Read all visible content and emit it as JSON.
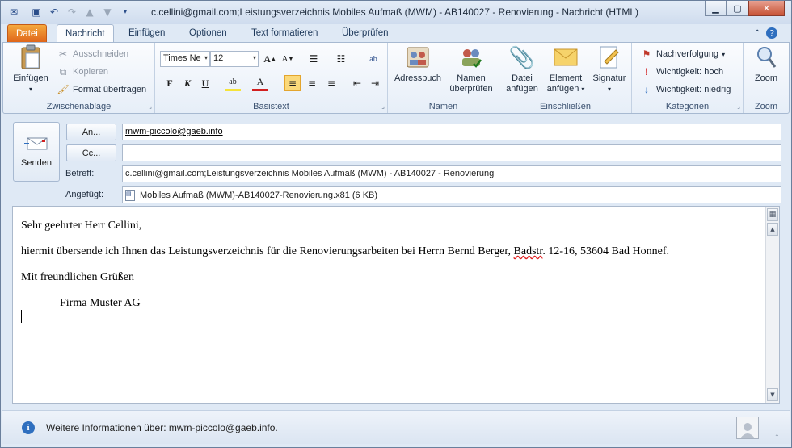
{
  "window": {
    "title": "c.cellini@gmail.com;Leistungsverzeichnis Mobiles Aufmaß (MWM) - AB140027 - Renovierung  -  Nachricht (HTML)"
  },
  "quick_access": [
    "outlook-icon",
    "save-icon",
    "undo-icon",
    "redo-icon",
    "up-icon",
    "down-icon",
    "customize-icon"
  ],
  "window_controls": {
    "minimize": "▁",
    "maximize": "▢",
    "close": "✕"
  },
  "tabs": [
    {
      "label": "Datei"
    },
    {
      "label": "Nachricht"
    },
    {
      "label": "Einfügen"
    },
    {
      "label": "Optionen"
    },
    {
      "label": "Text formatieren"
    },
    {
      "label": "Überprüfen"
    }
  ],
  "ribbon": {
    "zwischenablage": {
      "label": "Zwischenablage",
      "einfuegen": "Einfügen",
      "ausschneiden": "Ausschneiden",
      "kopieren": "Kopieren",
      "format": "Format übertragen"
    },
    "basistext": {
      "label": "Basistext",
      "font": "Times Ne",
      "size": "12",
      "bold": "F",
      "italic": "K",
      "underline": "U"
    },
    "namen": {
      "label": "Namen",
      "adressbuch": "Adressbuch",
      "namen_line1": "Namen",
      "namen_line2": "überprüfen"
    },
    "einschliessen": {
      "label": "Einschließen",
      "datei_line1": "Datei",
      "datei_line2": "anfügen",
      "element_line1": "Element",
      "element_line2": "anfügen",
      "signatur": "Signatur"
    },
    "kategorien": {
      "label": "Kategorien",
      "nachverfolgung": "Nachverfolgung",
      "wichtig_hoch": "Wichtigkeit: hoch",
      "wichtig_niedrig": "Wichtigkeit: niedrig"
    },
    "zoom": {
      "label": "Zoom",
      "zoom": "Zoom"
    }
  },
  "header": {
    "send_label": "Senden",
    "to_button": "An...",
    "cc_button": "Cc...",
    "subject_label": "Betreff:",
    "attached_label": "Angefügt:",
    "to_value": "mwm-piccolo@gaeb.info",
    "cc_value": "",
    "subject_value": "c.cellini@gmail.com;Leistungsverzeichnis Mobiles Aufmaß (MWM) - AB140027 - Renovierung",
    "attachment": "Mobiles Aufmaß (MWM)-AB140027-Renovierung.x81 (6 KB)"
  },
  "body": {
    "greeting": "Sehr geehrter Herr Cellini,",
    "line1_a": "hiermit übersende ich Ihnen das Leistungsverzeichnis für die Renovierungsarbeiten bei Herrn Bernd Berger, ",
    "line1_b": "Badstr",
    "line1_c": ". 12-16, 53604 Bad Honnef.",
    "closing": "Mit freundlichen Grüßen",
    "signature": "Firma Muster AG"
  },
  "infobar": {
    "text": "Weitere Informationen über: mwm-piccolo@gaeb.info."
  },
  "colors": {
    "accent": "#e0661b",
    "ribbon_bg": "#dfe9f5",
    "info": "#2f6fbf"
  }
}
